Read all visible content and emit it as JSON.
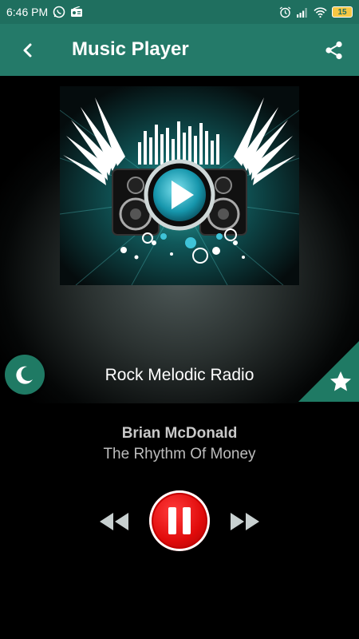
{
  "status_bar": {
    "time": "6:46 PM",
    "battery": "15",
    "left_icons": [
      "whatsapp-icon",
      "radio-icon"
    ],
    "right_icons": [
      "alarm-icon",
      "signal-icon",
      "wifi-icon",
      "battery-icon"
    ]
  },
  "header": {
    "title": "Music Player",
    "back_icon": "back-arrow-icon",
    "share_icon": "share-icon"
  },
  "player": {
    "station_name": "Rock Melodic Radio",
    "artist": "Brian McDonald",
    "song": "The Rhythm Of Money",
    "sleep_icon": "moon-icon",
    "favorite_icon": "star-icon",
    "controls": [
      "rewind-icon",
      "pause-icon",
      "fast-forward-icon"
    ]
  },
  "colors": {
    "status_bar": "#1f6f5f",
    "app_bar": "#247a69",
    "accent": "#1f7a64",
    "pause": "#e00b0b"
  }
}
